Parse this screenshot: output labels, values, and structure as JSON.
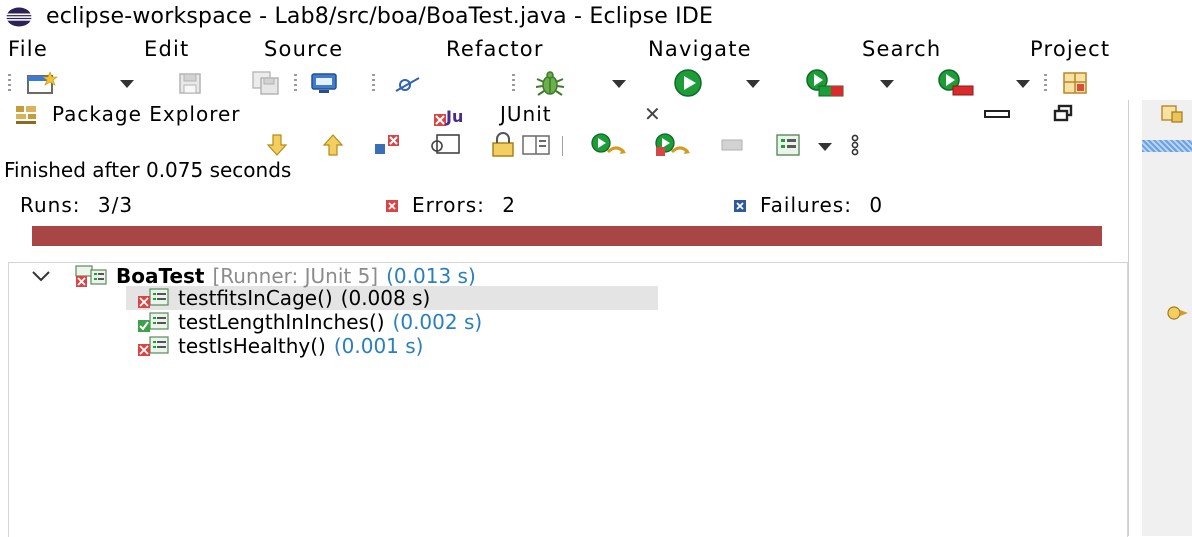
{
  "window": {
    "title": "eclipse-workspace - Lab8/src/boa/BoaTest.java - Eclipse IDE",
    "app_icon": "eclipse-icon"
  },
  "menu": {
    "items": [
      "File",
      "Edit",
      "Source",
      "Refactor",
      "Navigate",
      "Search",
      "Project"
    ]
  },
  "toolbar": {
    "icons": [
      "new-wizard-icon",
      "dropdown-arrow-icon",
      "save-icon",
      "save-all-icon",
      "terminal-icon",
      "skip-breakpoints-icon",
      "debug-bug-icon",
      "run-icon",
      "coverage-icon",
      "external-tools-icon",
      "open-perspective-icon"
    ]
  },
  "tabs": {
    "package_explorer": "Package Explorer",
    "junit": "JUnit",
    "junit_close": "✕"
  },
  "junit": {
    "status": "Finished after 0.075 seconds",
    "runs_label": "Runs:",
    "runs_value": "3/3",
    "errors_label": "Errors:",
    "errors_value": "2",
    "failures_label": "Failures:",
    "failures_value": "0",
    "progress_status": "error",
    "progress_fraction": 1.0
  },
  "tree": {
    "root": {
      "name": "BoaTest",
      "runner": "[Runner: JUnit 5]",
      "time": "(0.013 s)"
    },
    "children": [
      {
        "name": "testfitsInCage()",
        "time": "(0.008 s)",
        "status": "error",
        "selected": true
      },
      {
        "name": "testLengthInInches()",
        "time": "(0.002 s)",
        "status": "passed",
        "selected": false
      },
      {
        "name": "testIsHealthy()",
        "time": "(0.001 s)",
        "status": "error",
        "selected": false
      }
    ]
  },
  "colors": {
    "error_bar": "#a84646",
    "time_text": "#2a7fbf",
    "runner_text": "#8c8c8c"
  }
}
